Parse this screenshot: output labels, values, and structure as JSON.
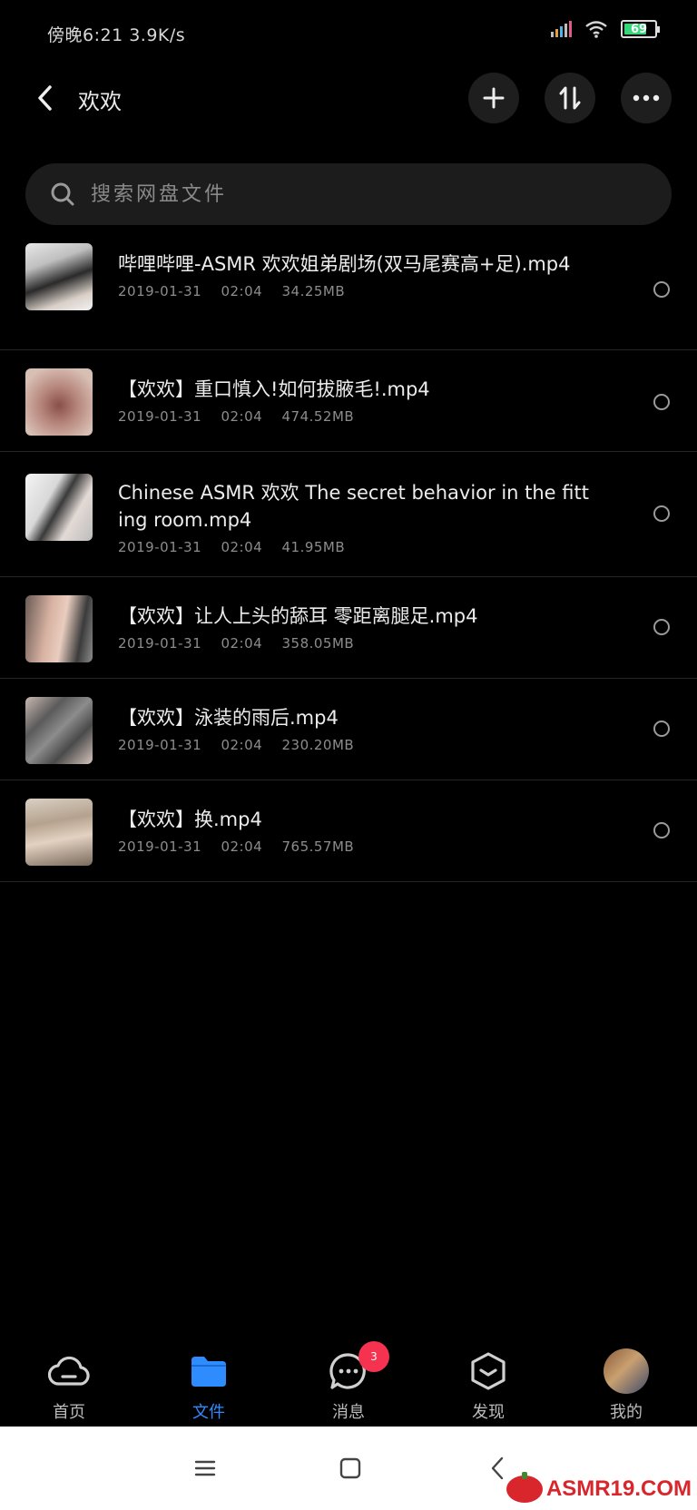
{
  "status_bar": {
    "time": "傍晚6:21",
    "speed": "3.9K/s",
    "battery": "69"
  },
  "header": {
    "title": "欢欢"
  },
  "search": {
    "placeholder": "搜索网盘文件"
  },
  "files": [
    {
      "name": "哔哩哔哩-ASMR 欢欢姐弟剧场(双马尾赛高+足).mp4",
      "date": "2019-01-31",
      "time": "02:04",
      "size": "34.25MB"
    },
    {
      "name": "【欢欢】重口慎入!如何拔腋毛!.mp4",
      "date": "2019-01-31",
      "time": "02:04",
      "size": "474.52MB"
    },
    {
      "name": "Chinese ASMR 欢欢 The secret behavior in the fitting room.mp4",
      "date": "2019-01-31",
      "time": "02:04",
      "size": "41.95MB"
    },
    {
      "name": "【欢欢】让人上头的舔耳 零距离腿足.mp4",
      "date": "2019-01-31",
      "time": "02:04",
      "size": "358.05MB"
    },
    {
      "name": "【欢欢】泳装的雨后.mp4",
      "date": "2019-01-31",
      "time": "02:04",
      "size": "230.20MB"
    },
    {
      "name": "【欢欢】换.mp4",
      "date": "2019-01-31",
      "time": "02:04",
      "size": "765.57MB"
    }
  ],
  "bottom_nav": {
    "home": "首页",
    "files": "文件",
    "messages": "消息",
    "messages_badge": "3",
    "discover": "发现",
    "mine": "我的"
  },
  "watermark": "ASMR19.COM",
  "colors": {
    "accent": "#2f8cff",
    "badge": "#f5324f",
    "battery": "#37d67a"
  }
}
